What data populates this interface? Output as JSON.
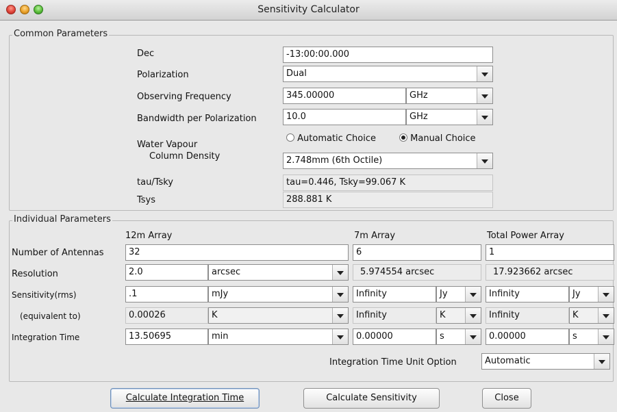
{
  "window": {
    "title": "Sensitivity Calculator"
  },
  "common": {
    "legend": "Common Parameters",
    "dec_label": "Dec",
    "dec_value": "-13:00:00.000",
    "pol_label": "Polarization",
    "pol_value": "Dual",
    "freq_label": "Observing Frequency",
    "freq_value": "345.00000",
    "freq_unit": "GHz",
    "bw_label": "Bandwidth per Polarization",
    "bw_value": "10.0",
    "bw_unit": "GHz",
    "wv_label_1": "Water Vapour",
    "wv_label_2": "Column Density",
    "wv_auto": "Automatic Choice",
    "wv_manual": "Manual Choice",
    "wv_selected": "manual",
    "wv_value": "2.748mm (6th Octile)",
    "tau_label": "tau/Tsky",
    "tau_value": "tau=0.446, Tsky=99.067 K",
    "tsys_label": "Tsys",
    "tsys_value": "288.881 K"
  },
  "individual": {
    "legend": "Individual Parameters",
    "col_12m": "12m Array",
    "col_7m": "7m Array",
    "col_tp": "Total Power Array",
    "row_antennas": "Number of Antennas",
    "row_resolution": "Resolution",
    "row_sensitivity": "Sensitivity(rms)",
    "row_equiv": "(equivalent to)",
    "row_time": "Integration Time",
    "ant_12m": "32",
    "ant_7m": "6",
    "ant_tp": "1",
    "res_12m": "2.0",
    "res_12m_unit": "arcsec",
    "res_7m": "5.974554 arcsec",
    "res_tp": "17.923662 arcsec",
    "sens_12m": ".1",
    "sens_12m_unit": "mJy",
    "sens_7m": "Infinity",
    "sens_7m_unit": "Jy",
    "sens_tp": "Infinity",
    "sens_tp_unit": "Jy",
    "eq_12m": "0.00026",
    "eq_12m_unit": "K",
    "eq_7m": "Infinity",
    "eq_7m_unit": "K",
    "eq_tp": "Infinity",
    "eq_tp_unit": "K",
    "time_12m": "13.50695",
    "time_12m_unit": "min",
    "time_7m": "0.00000",
    "time_7m_unit": "s",
    "time_tp": "0.00000",
    "time_tp_unit": "s",
    "unit_option_label": "Integration Time Unit Option",
    "unit_option_value": "Automatic"
  },
  "buttons": {
    "calc_time": "Calculate Integration Time",
    "calc_sens": "Calculate Sensitivity",
    "close": "Close"
  }
}
